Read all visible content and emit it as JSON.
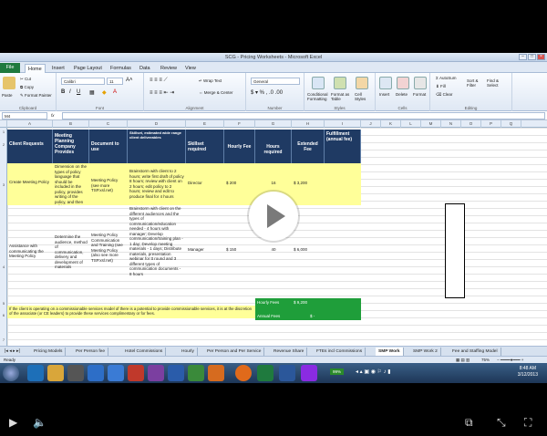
{
  "window": {
    "title": "SCG - Pricing Worksheets - Microsoft Excel"
  },
  "ribbon": {
    "file_tab": "File",
    "tabs": [
      "Home",
      "Insert",
      "Page Layout",
      "Formulas",
      "Data",
      "Review",
      "View"
    ],
    "clipboard": {
      "cut": "Cut",
      "copy": "Copy",
      "format_painter": "Format Painter",
      "paste": "Paste",
      "label": "Clipboard"
    },
    "font": {
      "name": "Calibri",
      "size": "11",
      "label": "Font"
    },
    "alignment": {
      "wrap": "Wrap Text",
      "merge": "Merge & Center",
      "label": "Alignment"
    },
    "number": {
      "format": "General",
      "label": "Number"
    },
    "styles": {
      "cond": "Conditional Formatting",
      "table": "Format as Table",
      "cell": "Cell Styles",
      "label": "Styles"
    },
    "cells": {
      "insert": "Insert",
      "delete": "Delete",
      "format": "Format",
      "label": "Cells"
    },
    "editing": {
      "autosum": "AutoSum",
      "fill": "Fill",
      "clear": "Clear",
      "sort": "Sort & Filter",
      "find": "Find & Select",
      "label": "Editing"
    }
  },
  "namebox": "M4",
  "columns": [
    "A",
    "B",
    "C",
    "D",
    "E",
    "F",
    "G",
    "H",
    "I",
    "J",
    "K",
    "L",
    "M",
    "N",
    "O",
    "P",
    "Q"
  ],
  "rows": [
    "1",
    "2",
    "3",
    "4",
    "5",
    "6",
    "7",
    "8",
    "9",
    "10",
    "11",
    "12",
    "13",
    "14",
    "15",
    "16",
    "17",
    "18",
    "19",
    "20",
    "21",
    "22",
    "23",
    "24",
    "25",
    "26",
    "27",
    "28",
    "29",
    "30"
  ],
  "table": {
    "headers": [
      "Client Requests",
      "Meeting Planning Company Provides",
      "Document to use",
      "Skillset, estimated wide range client deliverables",
      "Skillset required",
      "Hourly Fee",
      "Hours required",
      "Extended Fee",
      "Fulfillment (annual fee)"
    ],
    "row1": {
      "request": "Create Meeting Policy",
      "provides": "Dimension on the types of policy language that should be included in the policy, provides writing of the policy, and then editing",
      "doc": "Meeting Policy (see more TSP.xsl.net)",
      "tasks": "Brainstorm with client to 2 hours; write first draft of policy 8 hours; review with client on 2 hours; edit policy to 2 hours; review and edit to produce final for 4 hours",
      "skill": "Director",
      "fee": "$    200",
      "hours": "16",
      "extended": "$    3,200"
    },
    "row2": {
      "request": "Assistance with communicating the Meeting Policy",
      "provides": "Determine the audience, method of communication, delivery and development of materials",
      "doc": "Meeting Policy Communication and Training (see Meeting Policy (also see more TSP.xsl.net)",
      "tasks": "Brainstorm with client on the different audiences and the types of communication/education needed - 4 hours with manager; Develop communication/training plan - 1 day; Develop meeting materials - 1 days; Distribute materials, presentation webinar for tt round and 3 different types of communication documents - 8 hours",
      "skill": "Manager",
      "fee": "$    150",
      "hours": "40",
      "extended": "$    6,000"
    },
    "summary": {
      "hourly_label": "Hourly Fees",
      "hourly_value": "$    9,200",
      "annual_label": "Annual Fees",
      "annual_value": "$          -"
    },
    "note": "If the client is operating on a commissionable services model of there is a potential to provide commissionable services, it is at the discretion of the associate (or CE leaders) to provide these services complimentary or for fees."
  },
  "sheets": [
    "Pricing Models",
    "Per Person fee",
    "Hotel Commissions",
    "Hourly",
    "Per Person and Per Service",
    "Revenue Share",
    "FTEs incl Commissions",
    "SMP Work",
    "SMP Work 2",
    "Fee and Staffing Model"
  ],
  "active_sheet": "SMP Work",
  "status": {
    "ready": "Ready",
    "zoom": "75%"
  },
  "taskbar": {
    "time": "8:48 AM",
    "date": "3/12/2013",
    "battery": "99%"
  }
}
